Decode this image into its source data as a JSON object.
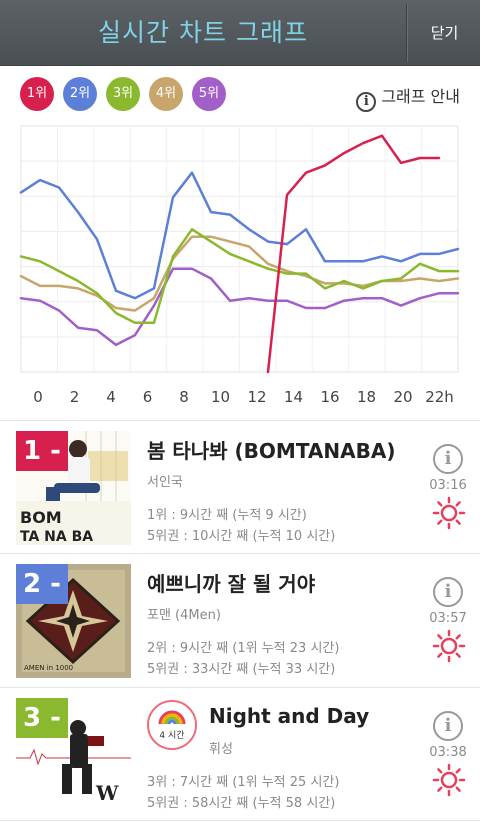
{
  "header": {
    "title": "실시간 차트 그래프",
    "close_label": "닫기"
  },
  "legend": {
    "ranks": [
      {
        "label": "1위",
        "color": "#d8204e"
      },
      {
        "label": "2위",
        "color": "#5e7fd8"
      },
      {
        "label": "3위",
        "color": "#8ab82f"
      },
      {
        "label": "4위",
        "color": "#c7a56b"
      },
      {
        "label": "5위",
        "color": "#a15fc7"
      }
    ],
    "guide_label": "그래프 안내",
    "guide_icon": "info-icon"
  },
  "chart_data": {
    "type": "line",
    "x_labels": [
      "0",
      "2",
      "4",
      "6",
      "8",
      "10",
      "12",
      "14",
      "16",
      "18",
      "20",
      "22h"
    ],
    "x": [
      0,
      1,
      2,
      3,
      4,
      5,
      6,
      7,
      8,
      9,
      10,
      11,
      12,
      13,
      14,
      15,
      16,
      17,
      18,
      19,
      20,
      21,
      22,
      23
    ],
    "y_label": "",
    "ylim": [
      0,
      100
    ],
    "grid": true,
    "series": [
      {
        "name": "1위",
        "color": "#d8204e",
        "start": 13,
        "values": [
          null,
          null,
          null,
          null,
          null,
          null,
          null,
          null,
          null,
          null,
          null,
          null,
          null,
          0,
          72,
          81,
          84,
          89,
          93,
          96,
          85,
          87,
          87
        ]
      },
      {
        "name": "2위",
        "color": "#5e7fd8",
        "values": [
          73,
          78,
          75,
          65,
          54,
          33,
          30,
          34,
          71,
          81,
          65,
          64,
          58,
          53,
          52,
          58,
          45,
          45,
          45,
          47,
          45,
          48,
          48,
          50
        ]
      },
      {
        "name": "3위",
        "color": "#8ab82f",
        "values": [
          47,
          45,
          41,
          37,
          32,
          24,
          20,
          20,
          47,
          58,
          53,
          48,
          45,
          42,
          40,
          40,
          34,
          37,
          34,
          37,
          38,
          44,
          41,
          41
        ]
      },
      {
        "name": "4위",
        "color": "#c7a56b",
        "values": [
          39,
          35,
          35,
          34,
          31,
          26,
          25,
          30,
          46,
          55,
          55,
          53,
          51,
          44,
          41,
          39,
          36,
          36,
          35,
          37,
          37,
          38,
          37,
          38
        ]
      },
      {
        "name": "5위",
        "color": "#a15fc7",
        "values": [
          30,
          29,
          25,
          18,
          17,
          11,
          15,
          27,
          42,
          42,
          38,
          29,
          30,
          29,
          29,
          26,
          26,
          29,
          30,
          30,
          27,
          30,
          32,
          32
        ]
      }
    ]
  },
  "songs": [
    {
      "rank_tag": "1 -",
      "rank_color": "#d8204e",
      "title": "봄 타나봐 (BOMTANABA)",
      "artist": "서인국",
      "stat1": "1위 : 9시간 째 (누적 9 시간)",
      "stat2": "5위권 : 10시간 째 (누적 10 시간)",
      "duration": "03:16",
      "cover_text": [
        "BOM",
        "TA   NA   BA"
      ],
      "info_icon": "info-icon",
      "sun_icon": "sun-icon"
    },
    {
      "rank_tag": "2 -",
      "rank_color": "#5e7fd8",
      "title": "예쁘니까 잘 될 거야",
      "artist": "포맨 (4Men)",
      "stat1": "2위 : 9시간 째 (1위 누적 23 시간)",
      "stat2": "5위권 : 33시간 째 (누적 33 시간)",
      "duration": "03:57",
      "cover_text": "AMEN in 1000",
      "info_icon": "info-icon",
      "sun_icon": "sun-icon"
    },
    {
      "rank_tag": "3 -",
      "rank_color": "#8ab82f",
      "title": "Night and Day",
      "artist": "휘성",
      "stat1": "3위 : 7시간 째 (1위 누적 25 시간)",
      "stat2": "5위권 : 58시간 째 (누적 58 시간)",
      "duration": "03:38",
      "badge": "4 시간",
      "badge_icon": "rainbow-icon",
      "info_icon": "info-icon",
      "sun_icon": "sun-icon"
    }
  ]
}
